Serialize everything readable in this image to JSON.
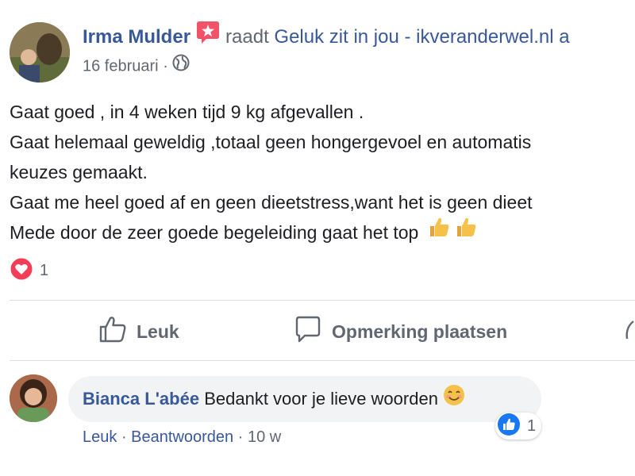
{
  "post": {
    "author": "Irma Mulder",
    "verb": "raadt",
    "page": "Geluk zit in jou - ikveranderwel.nl a",
    "date": "16 februari",
    "separator": "·",
    "paragraphs": [
      "Gaat goed , in 4 weken tijd 9 kg afgevallen .",
      "Gaat helemaal geweldig ,totaal geen hongergevoel en automatis",
      "keuzes gemaakt.",
      "Gaat me heel goed af en geen dieetstress,want het is geen dieet",
      "Mede door de zeer goede begeleiding gaat het top"
    ],
    "reaction_count": "1"
  },
  "actions": {
    "like_label": "Leuk",
    "comment_label": "Opmerking plaatsen"
  },
  "comment": {
    "author": "Bianca L'abée",
    "text": "Bedankt voor je lieve woorden",
    "like_count": "1",
    "like_link": "Leuk",
    "reply_link": "Beantwoorden",
    "time": "10 w",
    "dot": "·"
  },
  "colors": {
    "link": "#385898",
    "love": "#f33e58",
    "like": "#1877f2"
  },
  "icons": [
    "recommend-badge-icon",
    "globe-icon",
    "thumbs-up-emoji",
    "love-reaction-icon",
    "like-outline-icon",
    "comment-outline-icon",
    "share-icon",
    "smiling-emoji",
    "like-reaction-icon"
  ]
}
